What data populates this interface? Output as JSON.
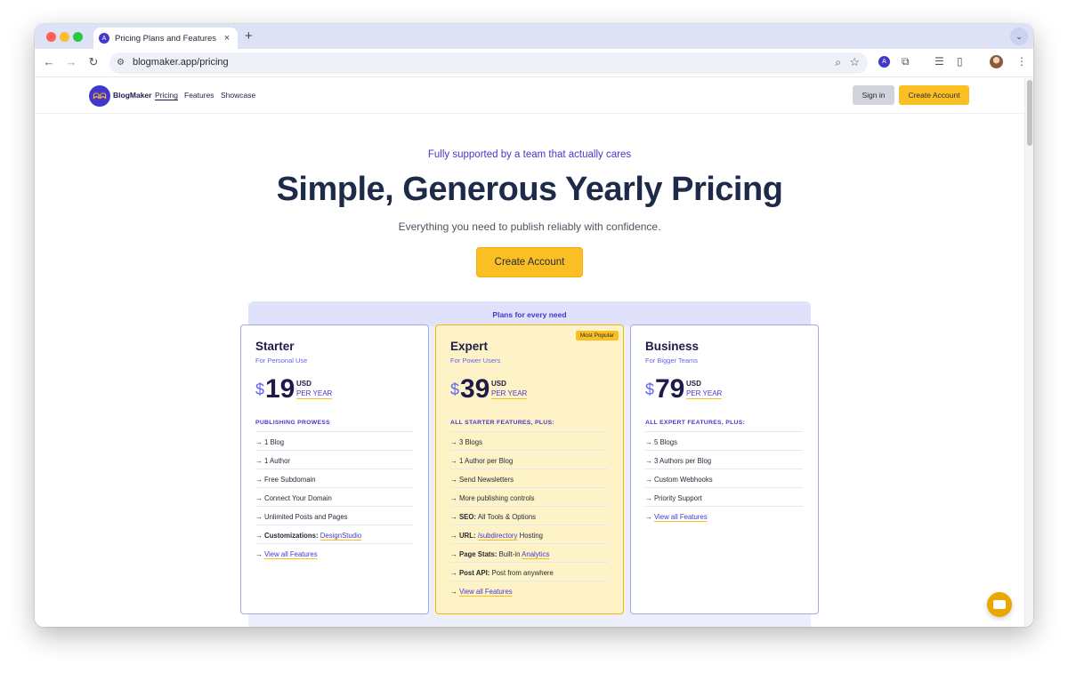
{
  "browser": {
    "tab_title": "Pricing Plans and Features",
    "tab_close": "×",
    "new_tab": "+",
    "url": "blogmaker.app/pricing",
    "favicon_letter": "A"
  },
  "header": {
    "brand": "BlogMaker",
    "nav": [
      "Pricing",
      "Features",
      "Showcase"
    ],
    "signin_label": "Sign in",
    "create_label": "Create Account"
  },
  "hero": {
    "eyebrow": "Fully supported by a team that actually cares",
    "title": "Simple, Generous Yearly Pricing",
    "subtitle": "Everything you need to publish reliably with confidence.",
    "cta_label": "Create Account"
  },
  "plans": {
    "banner": "Plans for every need",
    "cards": [
      {
        "name": "Starter",
        "tagline": "For Personal Use",
        "currency_symbol": "$",
        "price": "19",
        "currency": "USD",
        "period": "PER YEAR",
        "section_label": "PUBLISHING PROWESS",
        "features": [
          {
            "prefix": "→ ",
            "bold": "",
            "text": "1 Blog",
            "link": "",
            "suffix": ""
          },
          {
            "prefix": "→ ",
            "bold": "",
            "text": "1 Author",
            "link": "",
            "suffix": ""
          },
          {
            "prefix": "→ ",
            "bold": "",
            "text": "Free Subdomain",
            "link": "",
            "suffix": ""
          },
          {
            "prefix": "→ ",
            "bold": "",
            "text": "Connect Your Domain",
            "link": "",
            "suffix": ""
          },
          {
            "prefix": "→ ",
            "bold": "",
            "text": "Unlimited Posts and Pages",
            "link": "",
            "suffix": ""
          },
          {
            "prefix": "→ ",
            "bold": "Customizations:",
            "text": " ",
            "link": "DesignStudio",
            "suffix": ""
          },
          {
            "prefix": "→ ",
            "bold": "",
            "text": "",
            "link": "View all Features",
            "suffix": ""
          }
        ]
      },
      {
        "name": "Expert",
        "tagline": "For Power Users",
        "badge": "Most Popular",
        "currency_symbol": "$",
        "price": "39",
        "currency": "USD",
        "period": "PER YEAR",
        "section_label": "ALL STARTER FEATURES, PLUS:",
        "features": [
          {
            "prefix": "→ ",
            "bold": "",
            "text": "3 Blogs",
            "link": "",
            "suffix": ""
          },
          {
            "prefix": "→ ",
            "bold": "",
            "text": "1 Author per Blog",
            "link": "",
            "suffix": ""
          },
          {
            "prefix": "→ ",
            "bold": "",
            "text": "Send Newsletters",
            "link": "",
            "suffix": ""
          },
          {
            "prefix": "→ ",
            "bold": "",
            "text": "More publishing controls",
            "link": "",
            "suffix": ""
          },
          {
            "prefix": "→ ",
            "bold": "SEO:",
            "text": " All Tools & Options",
            "link": "",
            "suffix": ""
          },
          {
            "prefix": "→ ",
            "bold": "URL:",
            "text": " ",
            "link": "/subdirectory",
            "suffix": " Hosting"
          },
          {
            "prefix": "→ ",
            "bold": "Page Stats:",
            "text": " Built-in ",
            "link": "Analytics",
            "suffix": ""
          },
          {
            "prefix": "→ ",
            "bold": "Post API:",
            "text": " Post from anywhere",
            "link": "",
            "suffix": ""
          },
          {
            "prefix": "→ ",
            "bold": "",
            "text": "",
            "link": "View all Features",
            "suffix": ""
          }
        ]
      },
      {
        "name": "Business",
        "tagline": "For Bigger Teams",
        "currency_symbol": "$",
        "price": "79",
        "currency": "USD",
        "period": "PER YEAR",
        "section_label": "ALL EXPERT FEATURES, PLUS:",
        "features": [
          {
            "prefix": "→ ",
            "bold": "",
            "text": "5 Blogs",
            "link": "",
            "suffix": ""
          },
          {
            "prefix": "→ ",
            "bold": "",
            "text": "3 Authors per Blog",
            "link": "",
            "suffix": ""
          },
          {
            "prefix": "→ ",
            "bold": "",
            "text": "Custom Webhooks",
            "link": "",
            "suffix": ""
          },
          {
            "prefix": "→ ",
            "bold": "",
            "text": "Priority Support",
            "link": "",
            "suffix": ""
          },
          {
            "prefix": "→ ",
            "bold": "",
            "text": "",
            "link": "View all Features",
            "suffix": ""
          }
        ]
      }
    ]
  },
  "colors": {
    "accent": "#4338ca",
    "cta": "#fbbf24",
    "heading": "#1e2a4a",
    "featured_bg": "#fef3c7"
  },
  "icons": {
    "back": "back-arrow-icon",
    "forward": "forward-arrow-icon",
    "reload": "reload-icon",
    "chat": "chat-icon"
  }
}
